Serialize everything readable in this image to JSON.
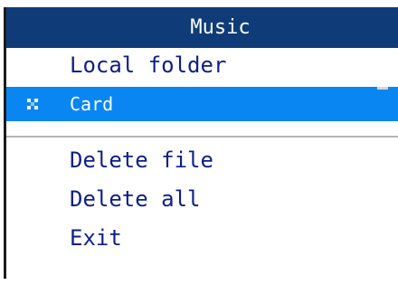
{
  "title": "Music",
  "menu": {
    "items": [
      {
        "label": "Local folder"
      },
      {
        "label": "Card",
        "selected": true
      },
      {
        "label": "Delete file"
      },
      {
        "label": "Delete all"
      },
      {
        "label": "Exit"
      }
    ]
  },
  "colors": {
    "title_bg": "#0f3c78",
    "selected_bg": "#0a86f3",
    "item_text": "#0d1f8a",
    "selected_text": "#ffffff"
  },
  "icons": {
    "selected_marker": "media-card-icon"
  }
}
